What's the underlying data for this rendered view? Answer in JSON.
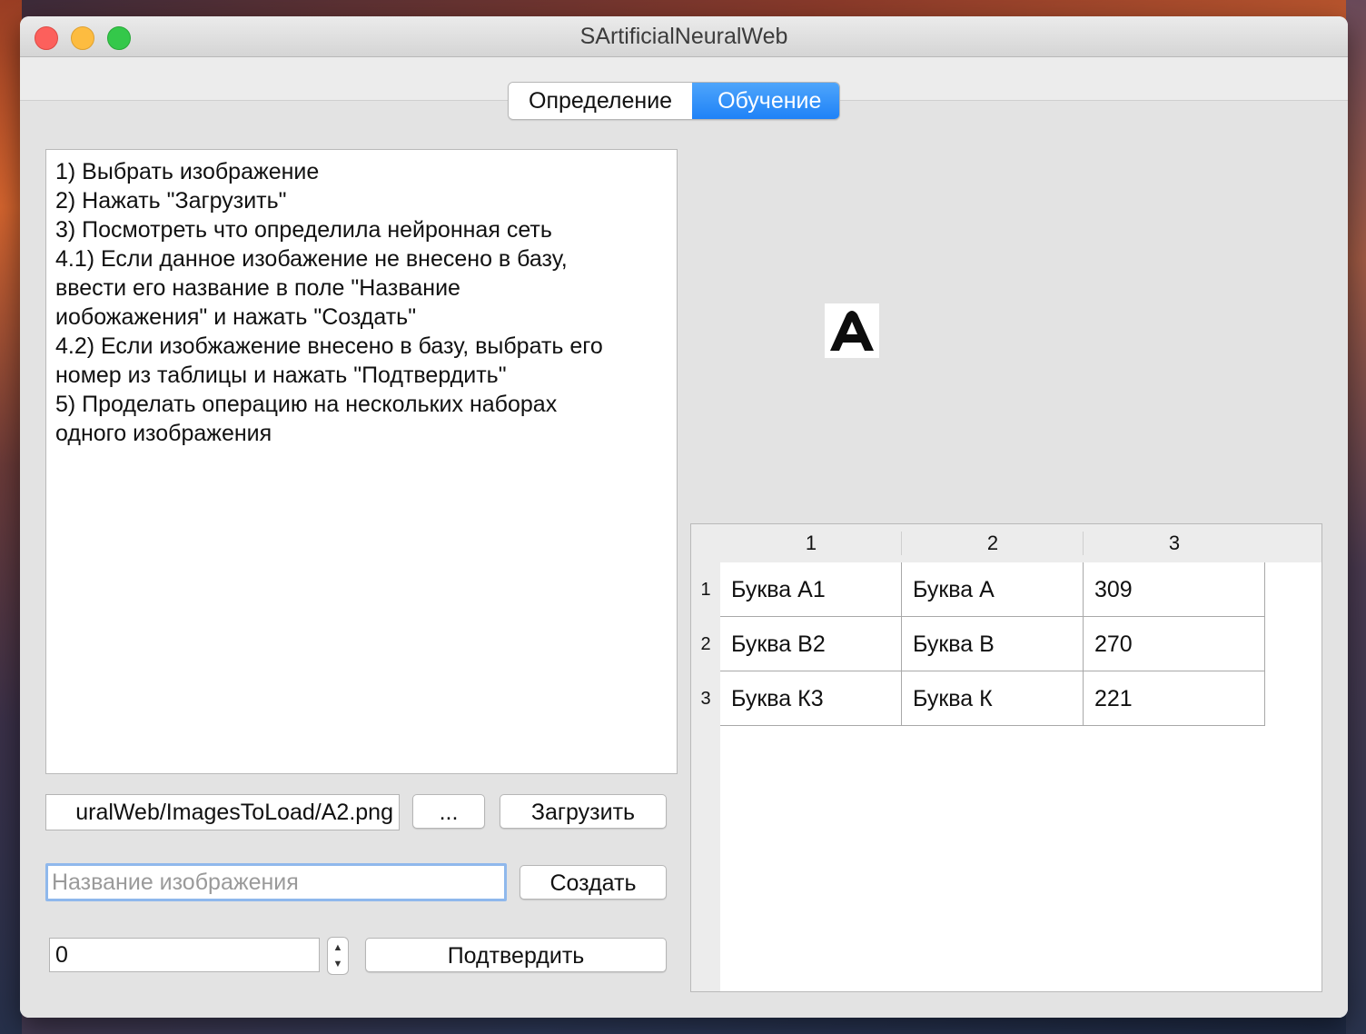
{
  "window": {
    "title": "SArtificialNeuralWeb"
  },
  "tabs": [
    {
      "label": "Определение",
      "active": false
    },
    {
      "label": "Обучение",
      "active": true
    }
  ],
  "instructions": {
    "lines": [
      "1) Выбрать изображение",
      "2) Нажать \"Загрузить\"",
      "3) Посмотреть что определила нейронная сеть",
      "4.1) Если данное изобажение не внесено в базу,",
      "ввести его название в поле \"Название",
      "иобожажения\" и нажать \"Создать\"",
      "4.2) Если изобжажение внесено в базу, выбрать его",
      "номер из таблицы и нажать \"Подтвердить\"",
      "5) Проделать операцию на нескольких наборах",
      "одного изображения"
    ]
  },
  "preview": {
    "glyph": "A"
  },
  "table": {
    "columns": [
      "1",
      "2",
      "3"
    ],
    "rows": [
      {
        "header": "1",
        "cells": [
          "Буква А1",
          "Буква А",
          "309"
        ]
      },
      {
        "header": "2",
        "cells": [
          "Буква В2",
          "Буква В",
          "270"
        ]
      },
      {
        "header": "3",
        "cells": [
          "Буква К3",
          "Буква К",
          "221"
        ]
      }
    ]
  },
  "load": {
    "path_value": "uralWeb/ImagesToLoad/A2.png",
    "browse_label": "...",
    "load_label": "Загрузить"
  },
  "create": {
    "placeholder": "Название изображения",
    "create_label": "Создать"
  },
  "confirm": {
    "number_value": "0",
    "confirm_label": "Подтвердить"
  },
  "colors": {
    "tab_active": "#1f82f7",
    "focus_ring": "#8fb8ec",
    "close": "#fc605c",
    "minimize": "#fdbc40",
    "zoom": "#34c84a"
  }
}
